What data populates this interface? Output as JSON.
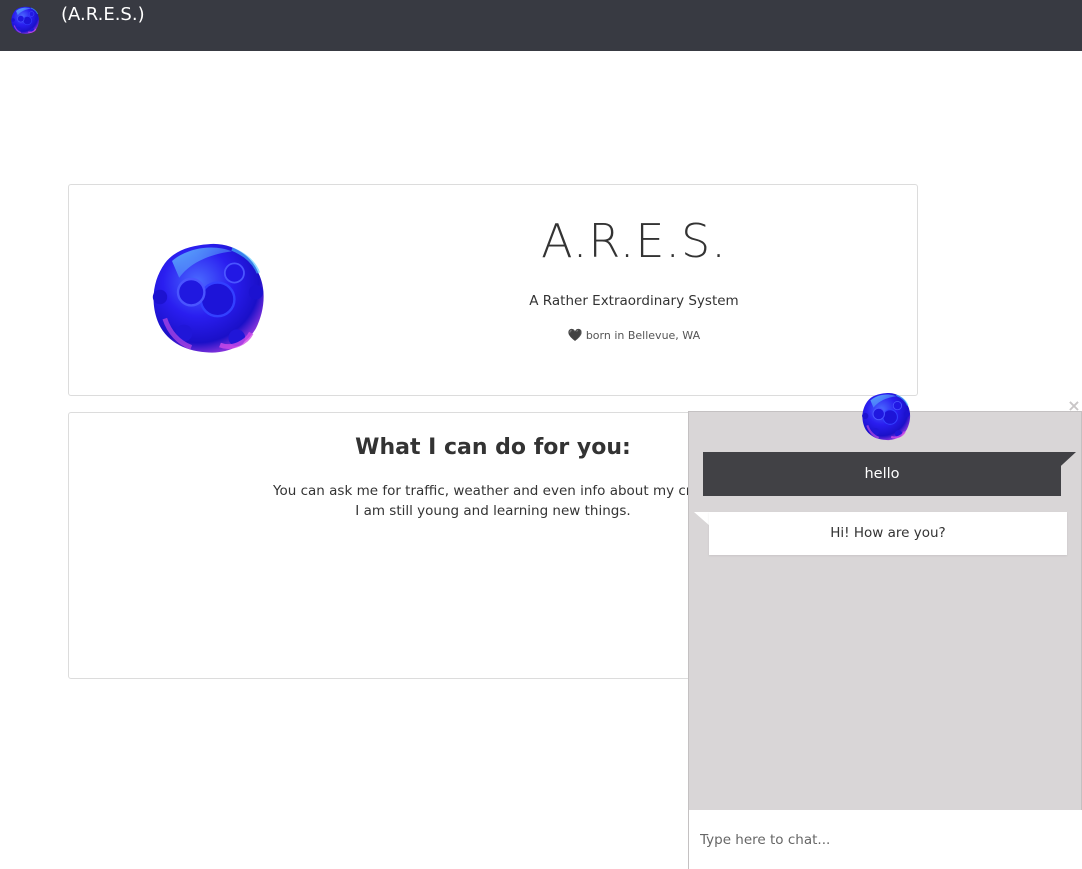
{
  "navbar": {
    "title": "(A.R.E.S.)",
    "logo_icon": "orb-logo-icon"
  },
  "hero": {
    "title": "A.R.E.S.",
    "subtitle": "A Rather Extraordinary System",
    "born_text": "born in Bellevue, WA",
    "heart_icon": "🖤",
    "orb_icon": "orb-icon"
  },
  "features": {
    "heading": "What I can do for you:",
    "line1": "You can ask me for traffic, weather and even info about my creat",
    "line2": "I am still young and learning new things."
  },
  "chat": {
    "close_icon": "×",
    "messages": [
      {
        "from": "user",
        "text": "hello"
      },
      {
        "from": "bot",
        "text": "Hi! How are you?"
      }
    ],
    "input_placeholder": "Type here to chat..."
  },
  "colors": {
    "navbar_bg": "#383a42",
    "chat_bg": "#d9d6d7",
    "user_bubble": "#414145",
    "orb_primary": "#2a1ef0",
    "orb_accent": "#c04be0"
  }
}
